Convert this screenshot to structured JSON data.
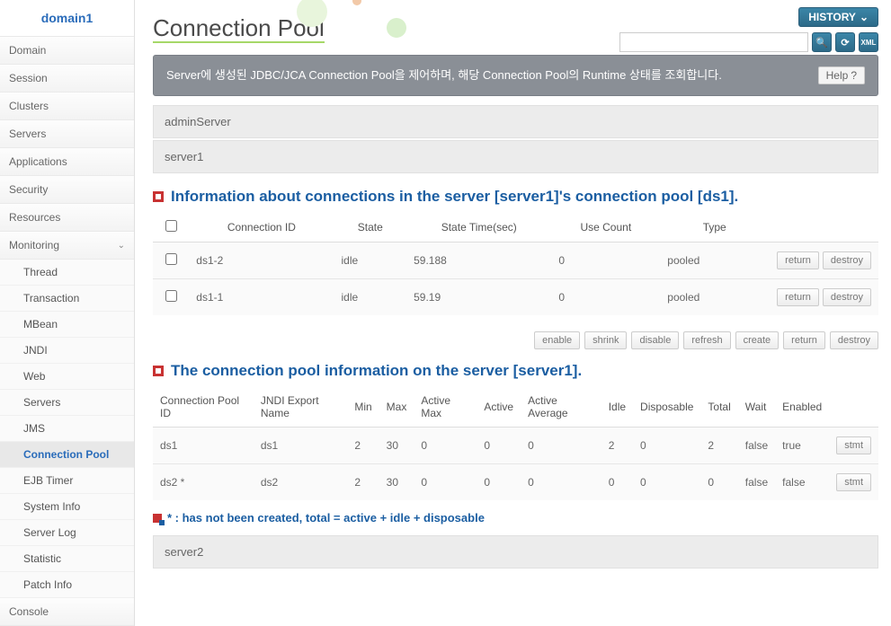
{
  "domain_title": "domain1",
  "nav": {
    "items": [
      "Domain",
      "Session",
      "Clusters",
      "Servers",
      "Applications",
      "Security",
      "Resources",
      "Monitoring",
      "Console"
    ],
    "monitoring_sub": [
      "Thread",
      "Transaction",
      "MBean",
      "JNDI",
      "Web",
      "Servers",
      "JMS",
      "Connection Pool",
      "EJB Timer",
      "System Info",
      "Server Log",
      "Statistic",
      "Patch Info"
    ],
    "active_sub": "Connection Pool"
  },
  "page": {
    "title": "Connection Pool",
    "history_btn": "HISTORY",
    "search_placeholder": "",
    "description": "Server에 생성된 JDBC/JCA Connection Pool을 제어하며, 해당 Connection Pool의 Runtime 상태를 조회합니다.",
    "help_btn": "Help"
  },
  "servers": {
    "admin": "adminServer",
    "s1": "server1",
    "s2": "server2"
  },
  "conn_section": {
    "title": "Information about connections in the server [server1]'s connection pool [ds1].",
    "headers": {
      "conn_id": "Connection ID",
      "state": "State",
      "state_time": "State Time(sec)",
      "use_count": "Use Count",
      "type": "Type"
    },
    "rows": [
      {
        "id": "ds1-2",
        "state": "idle",
        "time": "59.188",
        "use": "0",
        "type": "pooled"
      },
      {
        "id": "ds1-1",
        "state": "idle",
        "time": "59.19",
        "use": "0",
        "type": "pooled"
      }
    ],
    "actions": {
      "return": "return",
      "destroy": "destroy"
    }
  },
  "toolbar": {
    "enable": "enable",
    "shrink": "shrink",
    "disable": "disable",
    "refresh": "refresh",
    "create": "create",
    "return": "return",
    "destroy": "destroy"
  },
  "pool_section": {
    "title": "The connection pool information on the server [server1].",
    "headers": {
      "pool_id": "Connection Pool ID",
      "jndi": "JNDI Export Name",
      "min": "Min",
      "max": "Max",
      "amax": "Active Max",
      "active": "Active",
      "aavg": "Active Average",
      "idle": "Idle",
      "disp": "Disposable",
      "total": "Total",
      "wait": "Wait",
      "enabled": "Enabled"
    },
    "rows": [
      {
        "id": "ds1",
        "jndi": "ds1",
        "min": "2",
        "max": "30",
        "amax": "0",
        "active": "0",
        "aavg": "0",
        "idle": "2",
        "disp": "0",
        "total": "2",
        "wait": "false",
        "enabled": "true"
      },
      {
        "id": "ds2 *",
        "jndi": "ds2",
        "min": "2",
        "max": "30",
        "amax": "0",
        "active": "0",
        "aavg": "0",
        "idle": "0",
        "disp": "0",
        "total": "0",
        "wait": "false",
        "enabled": "false"
      }
    ],
    "stmt_btn": "stmt",
    "footnote": "* : has not been created, total = active + idle + disposable"
  }
}
